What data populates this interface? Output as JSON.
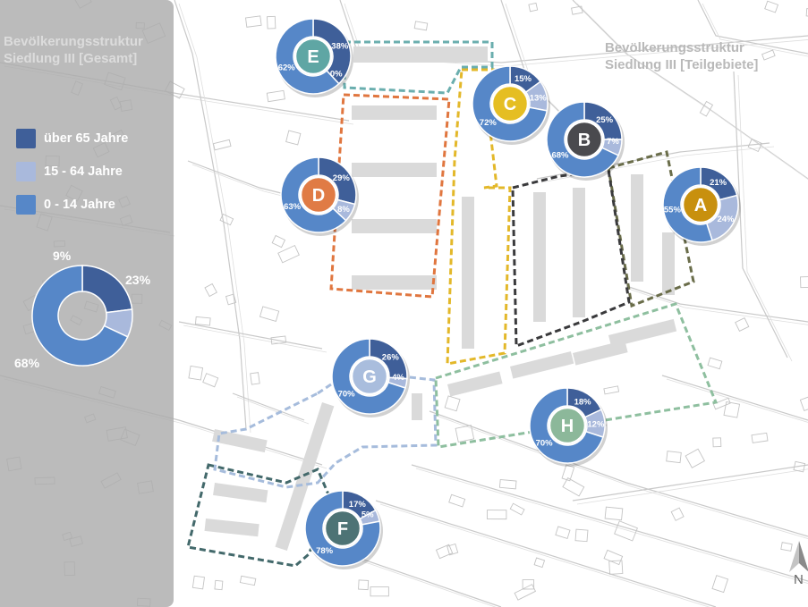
{
  "titles": {
    "left_line1": "Bevölkerungsstruktur",
    "left_line2": "Siedlung III [Gesamt]",
    "right_line1": "Bevölkerungsstruktur",
    "right_line2": "Siedlung III [Teilgebiete]"
  },
  "legend": [
    {
      "label": "über 65 Jahre",
      "color": "#3f5f99"
    },
    {
      "label": "15 - 64 Jahre",
      "color": "#a9b9dc"
    },
    {
      "label": "0 - 14 Jahre",
      "color": "#5687c8"
    }
  ],
  "overall": {
    "over65": 23,
    "age15to64": 9,
    "age0to14": 68,
    "labels": {
      "over65": "23%",
      "age15to64": "9%",
      "age0to14": "68%"
    }
  },
  "areas": [
    {
      "id": "A",
      "center_color": "#c8900e",
      "center_text": "#ffffff",
      "border_color": "#6a6d4a",
      "over65": 21,
      "age15to64": 24,
      "age0to14": 55,
      "labels": {
        "over65": "21%",
        "age15to64": "24%",
        "age0to14": "55%"
      }
    },
    {
      "id": "B",
      "center_color": "#4a4a4e",
      "center_text": "#ffffff",
      "border_color": "#3a3a3c",
      "over65": 25,
      "age15to64": 7,
      "age0to14": 68,
      "labels": {
        "over65": "25%",
        "age15to64": "7%",
        "age0to14": "68%"
      }
    },
    {
      "id": "C",
      "center_color": "#e5be23",
      "center_text": "#ffffff",
      "border_color": "#e3b82a",
      "over65": 15,
      "age15to64": 13,
      "age0to14": 72,
      "labels": {
        "over65": "15%",
        "age15to64": "13%",
        "age0to14": "72%"
      }
    },
    {
      "id": "D",
      "center_color": "#e07b45",
      "center_text": "#ffffff",
      "border_color": "#e0763f",
      "over65": 29,
      "age15to64": 8,
      "age0to14": 63,
      "labels": {
        "over65": "29%",
        "age15to64": "8%",
        "age0to14": "63%"
      }
    },
    {
      "id": "E",
      "center_color": "#5fa6a4",
      "center_text": "#ffffff",
      "border_color": "#6aaeae",
      "over65": 38,
      "age15to64": 0,
      "age0to14": 62,
      "labels": {
        "over65": "38%",
        "age15to64": "0%",
        "age0to14": "62%"
      }
    },
    {
      "id": "F",
      "center_color": "#4d7375",
      "center_text": "#ffffff",
      "border_color": "#43696b",
      "over65": 17,
      "age15to64": 5,
      "age0to14": 78,
      "labels": {
        "over65": "17%",
        "age15to64": "5%",
        "age0to14": "78%"
      }
    },
    {
      "id": "G",
      "center_color": "#a9bddd",
      "center_text": "#ffffff",
      "border_color": "#a6bcdc",
      "over65": 26,
      "age15to64": 4,
      "age0to14": 70,
      "labels": {
        "over65": "26%",
        "age15to64": "4%",
        "age0to14": "70%"
      }
    },
    {
      "id": "H",
      "center_color": "#8cb89a",
      "center_text": "#ffffff",
      "border_color": "#8ebf9f",
      "over65": 18,
      "age15to64": 12,
      "age0to14": 70,
      "labels": {
        "over65": "18%",
        "age15to64": "12%",
        "age0to14": "70%"
      }
    }
  ],
  "north_label": "N"
}
